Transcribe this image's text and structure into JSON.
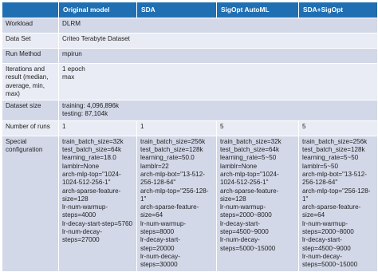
{
  "header": {
    "corner": "",
    "col1": "Original model",
    "col2": "SDA",
    "col3": "SigOpt AutoML",
    "col4": "SDA+SigOpt"
  },
  "rows": {
    "workload": {
      "label": "Workload",
      "value": "DLRM"
    },
    "dataset": {
      "label": "Data Set",
      "value": "Criteo Terabyte Dataset"
    },
    "run_method": {
      "label": "Run Method",
      "value": "mpirun"
    },
    "iterations": {
      "label": "Iterations and result (median, average, min, max)",
      "value": "1 epoch\nmax"
    },
    "dataset_size": {
      "label": "Dataset size",
      "value": "training: 4,096,896k\ntesting: 87,104k"
    },
    "num_runs": {
      "label": "Number of runs",
      "col1": "1",
      "col2": "1",
      "col3": "5",
      "col4": "5"
    },
    "special": {
      "label": "Special configuration",
      "col1": "train_batch_size=32k\ntest_batch_size=64k\nlearning_rate=18.0\nlamblr=None\narch-mlp-top=\"1024-1024-512-256-1\"\narch-sparse-feature-size=128\nlr-num-warmup-steps=4000\nlr-decay-start-step=5760\nlr-num-decay-steps=27000",
      "col2": "train_batch_size=256k\ntest_batch_size=128k\nlearning_rate=50.0\nlamblr=22\narch-mlp-bot=\"13-512-256-128-64\"\narch-mlp-top=\"256-128-1\"\narch-sparse-feature-size=64\nlr-num-warmup-steps=8000\nlr-decay-start-step=20000\nlr-num-decay-steps=30000",
      "col3": "train_batch_size=32k\ntest_batch_size=64k\nlearning_rate=5~50\nlamblr=None\narch-mlp-top=\"1024-1024-512-256-1\"\narch-sparse-feature-size=128\nlr-num-warmup-steps=2000~8000\nlr-decay-start-step=4500~9000\nlr-num-decay-steps=5000~15000",
      "col4": "train_batch_size=256k\ntest_batch_size=128k\nlearning_rate=5~50\nlamblr=5~50\narch-mlp-bot=\"13-512-256-128-64\"\narch-mlp-top=\"256-128-1\"\narch-sparse-feature-size=64\nlr-num-warmup-steps=2000~8000\nlr-decay-start-step=4500~9000\nlr-num-decay-steps=5000~15000"
    }
  }
}
